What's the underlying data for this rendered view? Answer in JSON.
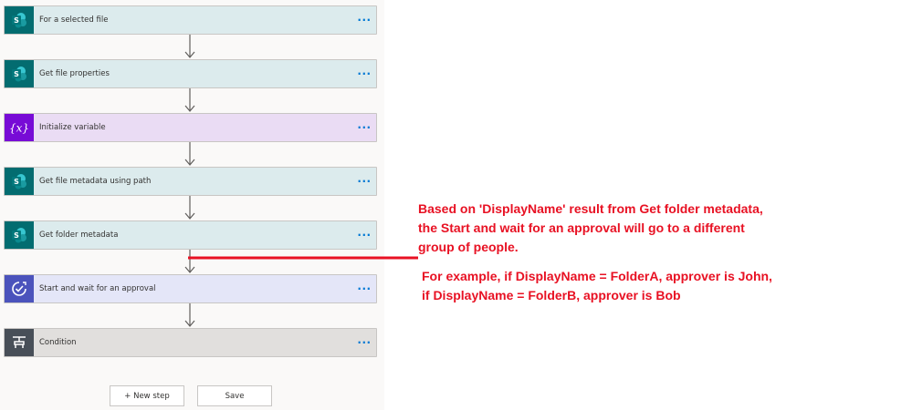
{
  "flow": {
    "steps": [
      {
        "title": "For a selected file",
        "icon": "sharepoint-icon",
        "kind": "sharepoint"
      },
      {
        "title": "Get file properties",
        "icon": "sharepoint-icon",
        "kind": "sharepoint"
      },
      {
        "title": "Initialize variable",
        "icon": "variable-icon",
        "kind": "variable"
      },
      {
        "title": "Get file metadata using path",
        "icon": "sharepoint-icon",
        "kind": "sharepoint"
      },
      {
        "title": "Get folder metadata",
        "icon": "sharepoint-icon",
        "kind": "sharepoint"
      },
      {
        "title": "Start and wait for an approval",
        "icon": "approval-icon",
        "kind": "approval"
      },
      {
        "title": "Condition",
        "icon": "condition-icon",
        "kind": "condition"
      }
    ],
    "more_label": "···",
    "new_step_label": "+ New step",
    "save_label": "Save"
  },
  "annotation": {
    "line1": "Based on 'DisplayName' result from Get folder metadata,",
    "line2": "the Start and wait for an approval will go to a different",
    "line3": "group of people.",
    "line4": "For example, if DisplayName = FolderA, approver is John,",
    "line5": "if DisplayName = FolderB, approver is Bob"
  },
  "colors": {
    "sharepoint": "#036c70",
    "variable": "#770bd6",
    "approval": "#4b53bc",
    "condition": "#484f58",
    "annotation": "#e81123",
    "accent": "#0078d4"
  }
}
